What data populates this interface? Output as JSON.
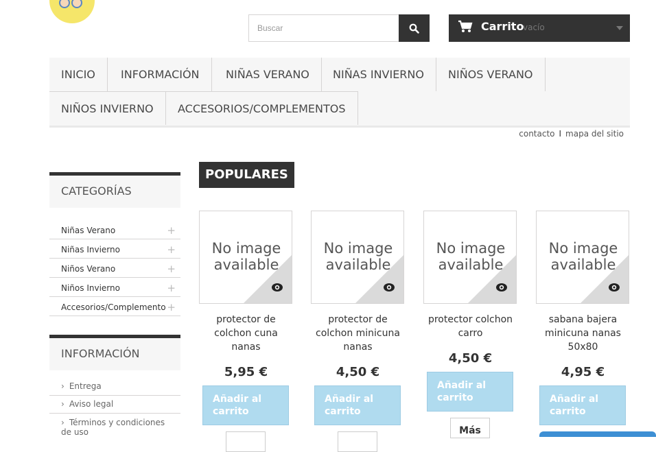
{
  "header": {
    "search": {
      "placeholder": "Buscar",
      "icon": "search-icon"
    },
    "cart": {
      "title": "Carrito",
      "status": "vacío",
      "icon": "shopping-cart-icon"
    }
  },
  "menu": [
    {
      "label": "INICIO"
    },
    {
      "label": "INFORMACIÓN"
    },
    {
      "label": "NIÑAS VERANO"
    },
    {
      "label": "NIÑAS INVIERNO"
    },
    {
      "label": "NIÑOS VERANO"
    },
    {
      "label": "NIÑOS INVIERNO"
    },
    {
      "label": "ACCESORIOS/COMPLEMENTOS"
    }
  ],
  "top_links": {
    "contact": "contacto",
    "separator": "I",
    "sitemap": "mapa del sitio"
  },
  "sidebar": {
    "categories_title": "CATEGORÍAS",
    "categories": [
      "Niñas Verano",
      "Niñas Invierno",
      "Niños Verano",
      "Niños Invierno",
      "Accesorios/Complementos"
    ],
    "expand_symbol": "+",
    "info_title": "INFORMACIÓN",
    "info_links": [
      "Entrega",
      "Aviso legal",
      "Términos y condiciones de uso"
    ],
    "bullet": "›"
  },
  "main": {
    "tab": "POPULARES",
    "no_image_text": "No image available",
    "add_label": "Añadir al carrito",
    "more_label": "Más",
    "products": [
      {
        "name": "protector de colchon cuna nanas",
        "price": "5,95 €"
      },
      {
        "name": "protector de colchon minicuna nanas",
        "price": "4,50 €"
      },
      {
        "name": "protector colchon carro",
        "price": "4,50 €"
      },
      {
        "name": "sabana bajera minicuna nanas 50x80",
        "price": "4,95 €"
      }
    ]
  },
  "colors": {
    "dark": "#333333",
    "add_button": "#b0dbef",
    "menu_bg": "#f6f6f6",
    "border": "#d6d4d4"
  }
}
